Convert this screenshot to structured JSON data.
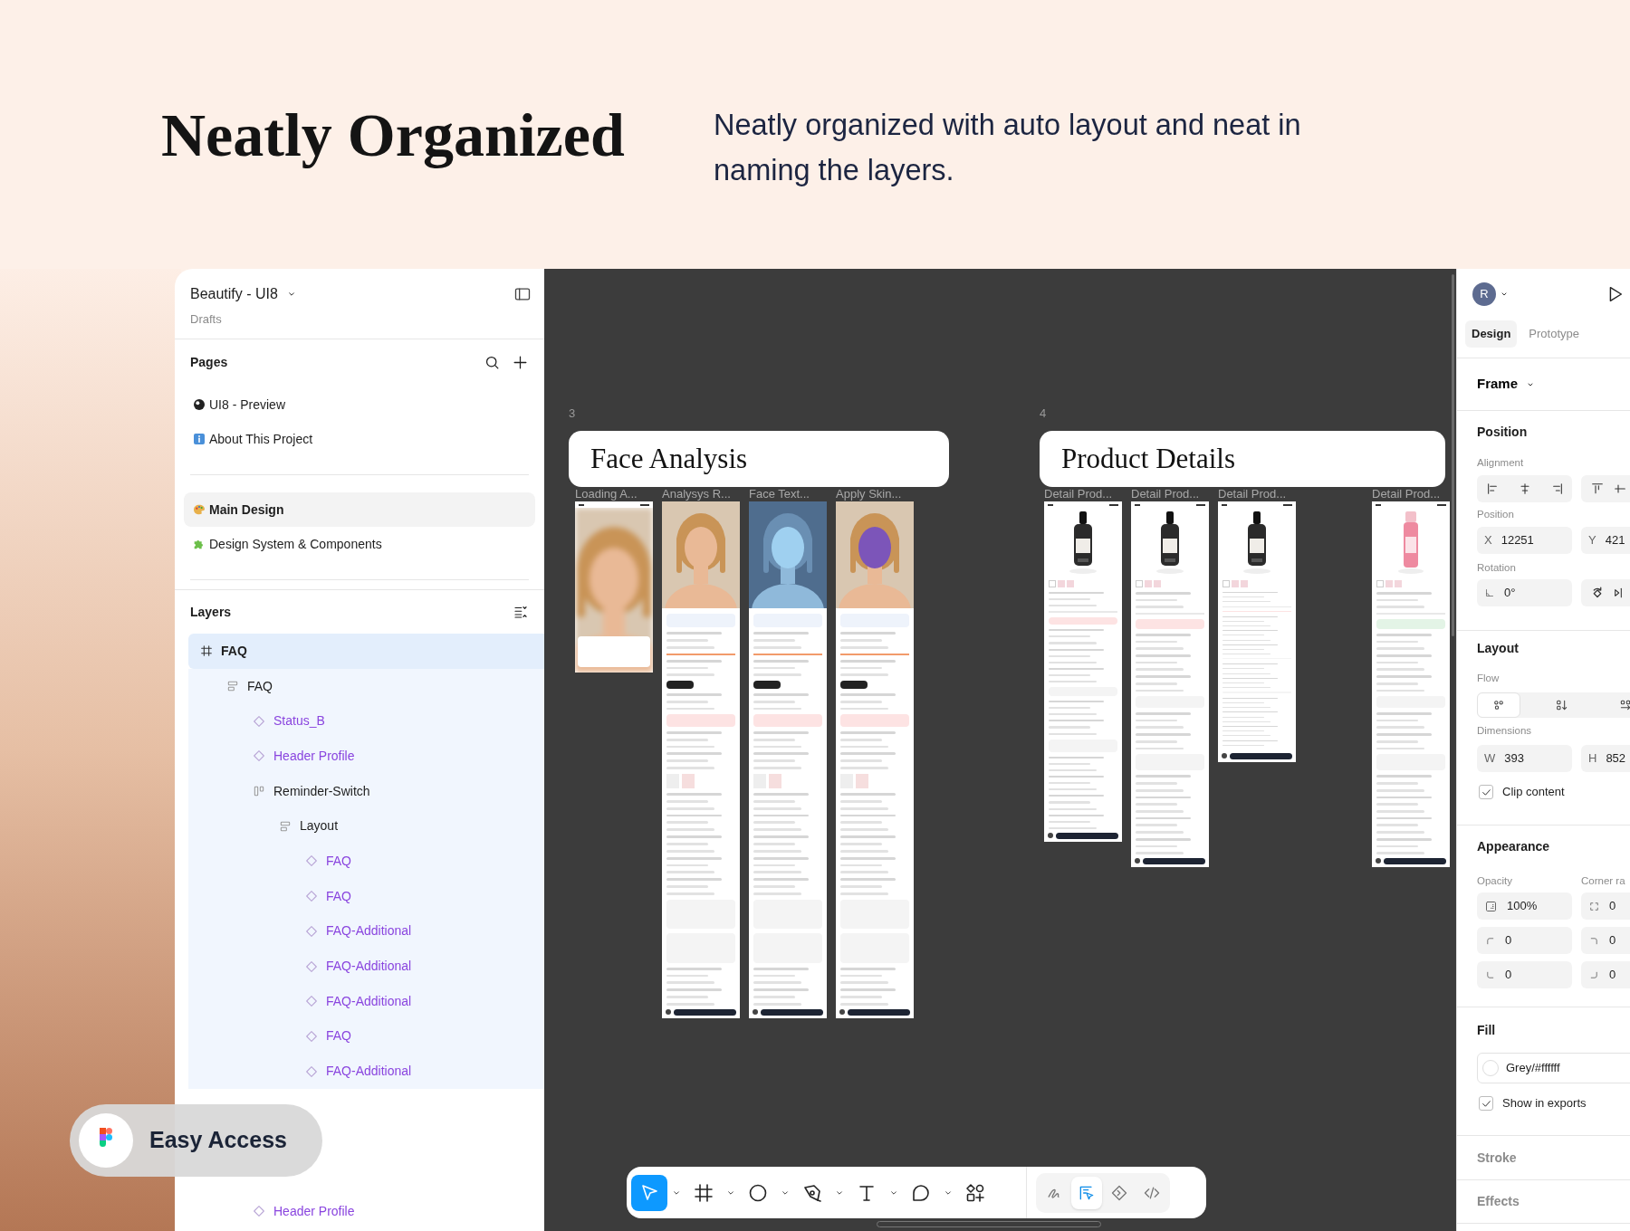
{
  "hero": {
    "title": "Neatly Organized",
    "description": "Neatly organized with auto layout and neat in naming the layers."
  },
  "left_panel": {
    "file_name": "Beautify - UI8",
    "location": "Drafts",
    "pages_heading": "Pages",
    "page_groups": [
      [
        {
          "label": "UI8 - Preview",
          "selected": false
        },
        {
          "label": "About This Project",
          "selected": false
        }
      ],
      [
        {
          "label": "Main Design",
          "selected": true
        },
        {
          "label": "Design System & Components",
          "selected": false
        }
      ]
    ],
    "layers_heading": "Layers",
    "layers": [
      {
        "name": "FAQ",
        "kind": "frame",
        "selected": true,
        "children": [
          {
            "name": "FAQ",
            "kind": "stack",
            "selected": false,
            "children": [
              {
                "name": "Status_B",
                "kind": "instance",
                "selected": false
              },
              {
                "name": "Header Profile",
                "kind": "instance",
                "selected": false
              },
              {
                "name": "Reminder-Switch",
                "kind": "row",
                "selected": false,
                "children": [
                  {
                    "name": "Layout",
                    "kind": "stack",
                    "selected": false,
                    "children": [
                      {
                        "name": "FAQ",
                        "kind": "instance",
                        "selected": false
                      },
                      {
                        "name": "FAQ",
                        "kind": "instance",
                        "selected": false
                      },
                      {
                        "name": "FAQ-Additional",
                        "kind": "instance",
                        "selected": false
                      },
                      {
                        "name": "FAQ-Additional",
                        "kind": "instance",
                        "selected": false
                      },
                      {
                        "name": "FAQ-Additional",
                        "kind": "instance",
                        "selected": false
                      },
                      {
                        "name": "FAQ",
                        "kind": "instance",
                        "selected": false
                      },
                      {
                        "name": "FAQ-Additional",
                        "kind": "instance",
                        "selected": false
                      }
                    ]
                  }
                ]
              }
            ]
          }
        ]
      },
      {
        "kind": "hidden",
        "children": [
          {
            "kind": "hidden",
            "children": [
              {
                "kind": "hidden"
              },
              {
                "name": "Header Profile",
                "kind": "instance",
                "selected": false
              }
            ]
          }
        ]
      }
    ]
  },
  "badge": {
    "label": "Easy Access"
  },
  "canvas": {
    "sections": [
      {
        "number": "3",
        "title": "Face Analysis",
        "frames": [
          {
            "label": "Loading A...",
            "kind": "loading"
          },
          {
            "label": "Analysys R...",
            "kind": "analysis"
          },
          {
            "label": "Face Text...",
            "kind": "texture"
          },
          {
            "label": "Apply Skin...",
            "kind": "mask"
          }
        ]
      },
      {
        "number": "4",
        "title": "Product Details",
        "frames": [
          {
            "label": "Detail Prod...",
            "kind": "product"
          },
          {
            "label": "Detail Prod...",
            "kind": "product"
          },
          {
            "label": "Detail Prod...",
            "kind": "product"
          },
          {
            "label": "Detail Prod...",
            "kind": "product-pink"
          }
        ]
      }
    ]
  },
  "toolbar": {
    "tools": [
      {
        "kind": "move",
        "selected": true,
        "menu": true
      },
      {
        "kind": "frame",
        "selected": false,
        "menu": true
      },
      {
        "kind": "ellipse",
        "selected": false,
        "menu": true
      },
      {
        "kind": "pen",
        "selected": false,
        "menu": true
      },
      {
        "kind": "text",
        "selected": false,
        "menu": true
      },
      {
        "kind": "comment",
        "selected": false,
        "menu": true
      },
      {
        "kind": "assets",
        "selected": false,
        "menu": false
      }
    ],
    "modes": [
      {
        "kind": "draw",
        "selected": false
      },
      {
        "kind": "design",
        "selected": true
      },
      {
        "kind": "plugins",
        "selected": false
      },
      {
        "kind": "dev",
        "selected": false
      }
    ]
  },
  "right_panel": {
    "avatar": "R",
    "tabs": [
      {
        "label": "Design",
        "selected": true
      },
      {
        "label": "Prototype",
        "selected": false
      }
    ],
    "selection": "Frame",
    "position": {
      "heading": "Position",
      "alignment_label": "Alignment",
      "position_label": "Position",
      "x": {
        "label": "X",
        "value": "12251"
      },
      "y": {
        "label": "Y",
        "value": "421"
      },
      "rotation_label": "Rotation",
      "rotation": "0°"
    },
    "layout": {
      "heading": "Layout",
      "flow_label": "Flow",
      "flows": [
        {
          "kind": "wrap",
          "selected": true
        },
        {
          "kind": "vertical",
          "selected": false
        },
        {
          "kind": "horizontal",
          "selected": false
        }
      ],
      "dimensions_label": "Dimensions",
      "width": {
        "label": "W",
        "value": "393"
      },
      "height": {
        "label": "H",
        "value": "852"
      },
      "clip": {
        "label": "Clip content",
        "checked": true
      }
    },
    "appearance": {
      "heading": "Appearance",
      "opacity_label": "Opacity",
      "corner_label": "Corner ra",
      "opacity": "100%",
      "corners": [
        "0",
        "0",
        "0",
        "0",
        "0"
      ]
    },
    "fill": {
      "heading": "Fill",
      "value": "Grey/#ffffff",
      "export": {
        "label": "Show in exports",
        "checked": true
      }
    },
    "stroke": {
      "heading": "Stroke"
    },
    "effects": {
      "heading": "Effects"
    }
  }
}
